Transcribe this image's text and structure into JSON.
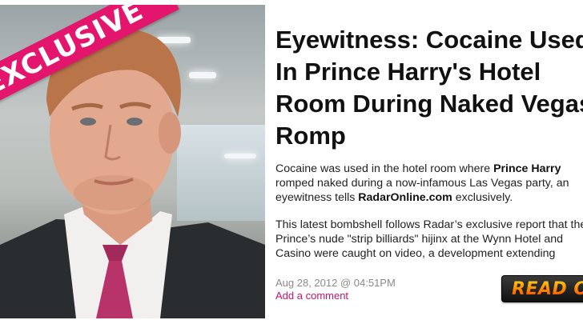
{
  "badge": {
    "label": "EXCLUSIVE"
  },
  "article": {
    "headline_lines": [
      "Eyewitness: Cocaine Used",
      "In Prince Harry's Hotel",
      "Room During Naked Vegas",
      "Romp"
    ],
    "paragraph1": {
      "line1_text": "Cocaine was used in the hotel room where ",
      "line1_bold": "Prince Harry",
      "line2": "romped naked during a now-infamous Las Vegas party, an",
      "line3_text": "eyewitness tells ",
      "line3_bold": "RadarOnline.com",
      "line3_end": " exclusively."
    },
    "paragraph2": {
      "line1": "This latest bombshell follows Radar’s exclusive report that the",
      "line2": "Prince’s nude \"strip billiards\" hijinx at the Wynn Hotel and",
      "line3": "Casino were caught on video, a development extending"
    },
    "date": "Aug 28, 2012 @ 04:51PM",
    "comment_link": "Add a comment",
    "read_button": "READ ON"
  },
  "colors": {
    "accent_pink": "#e4156c",
    "link_pink": "#c4166a",
    "button_bg": "#111111",
    "button_text": "#ff7a00"
  },
  "icons": {
    "photo": "portrait-photo"
  }
}
